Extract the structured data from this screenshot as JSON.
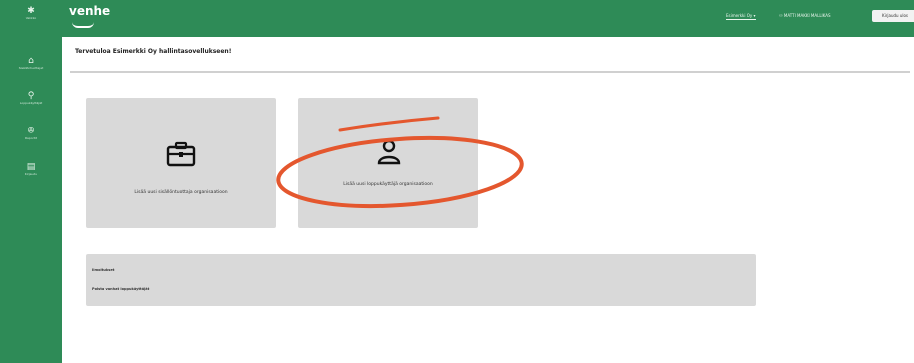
{
  "header": {
    "logo_text": "venhe",
    "org_select": "Esimerkki Oy ▾",
    "user_name": "MATTI MAKKI MALLIKAS",
    "logout_label": "Kirjaudu ulos"
  },
  "sidebar": {
    "menu_label": "Valikko",
    "items": [
      {
        "label": "Sisällöntuottajat",
        "icon": "building-icon"
      },
      {
        "label": "Loppukäyttäjät",
        "icon": "user-icon"
      },
      {
        "label": "Raportit",
        "icon": "group-icon"
      },
      {
        "label": "Kirjaudu",
        "icon": "document-icon"
      }
    ]
  },
  "main": {
    "title": "Tervetuloa Esimerkki Oy hallintasovellukseen!",
    "cards": [
      {
        "label": "Lisää uusi sisällöntuottaja organisaatioon",
        "icon": "briefcase-icon"
      },
      {
        "label": "Lisää uusi loppukäyttäjä organisaatioon",
        "icon": "person-icon"
      }
    ],
    "info": {
      "heading": "Ilmoitukset",
      "line": "Poista vanhat loppukäyttäjät"
    }
  },
  "colors": {
    "brand_green": "#2e8b57",
    "card_grey": "#d9d9d9",
    "annotation_orange": "#e4572e"
  }
}
